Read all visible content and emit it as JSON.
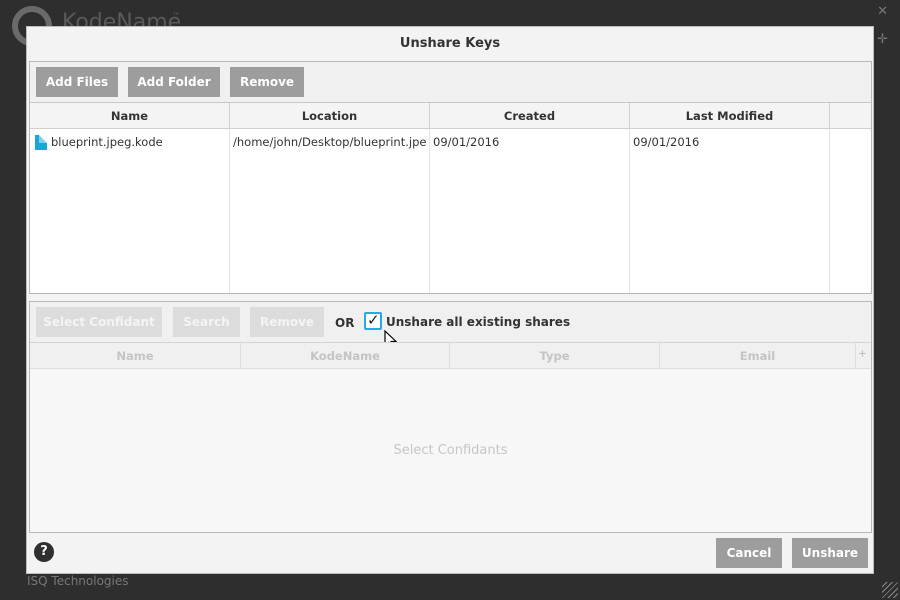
{
  "background": {
    "brand": "KodeName",
    "trademark": "™",
    "footer_text": "ISQ Technologies"
  },
  "dialog": {
    "title": "Unshare Keys"
  },
  "files_panel": {
    "buttons": {
      "add_files": "Add Files",
      "add_folder": "Add Folder",
      "remove": "Remove"
    },
    "columns": [
      "Name",
      "Location",
      "Created",
      "Last Modified"
    ],
    "rows": [
      {
        "name": "blueprint.jpeg.kode",
        "location": "/home/john/Desktop/blueprint.jpe...",
        "created": "09/01/2016",
        "last_modified": "09/01/2016"
      }
    ]
  },
  "confidants_panel": {
    "buttons": {
      "select_confidant": "Select Confidant",
      "search": "Search",
      "remove": "Remove"
    },
    "or_label": "OR",
    "unshare_all": {
      "label": "Unshare all existing shares",
      "checked": true
    },
    "columns": [
      "Name",
      "KodeName",
      "Type",
      "Email"
    ],
    "add_column_symbol": "+",
    "empty_message": "Select Confidants"
  },
  "footer": {
    "help_symbol": "?",
    "cancel": "Cancel",
    "unshare": "Unshare"
  },
  "colors": {
    "accent": "#2aa9de",
    "file_icon": "#1aa6d6",
    "button": "#9d9d9d",
    "button_disabled": "#dcdcdc"
  }
}
